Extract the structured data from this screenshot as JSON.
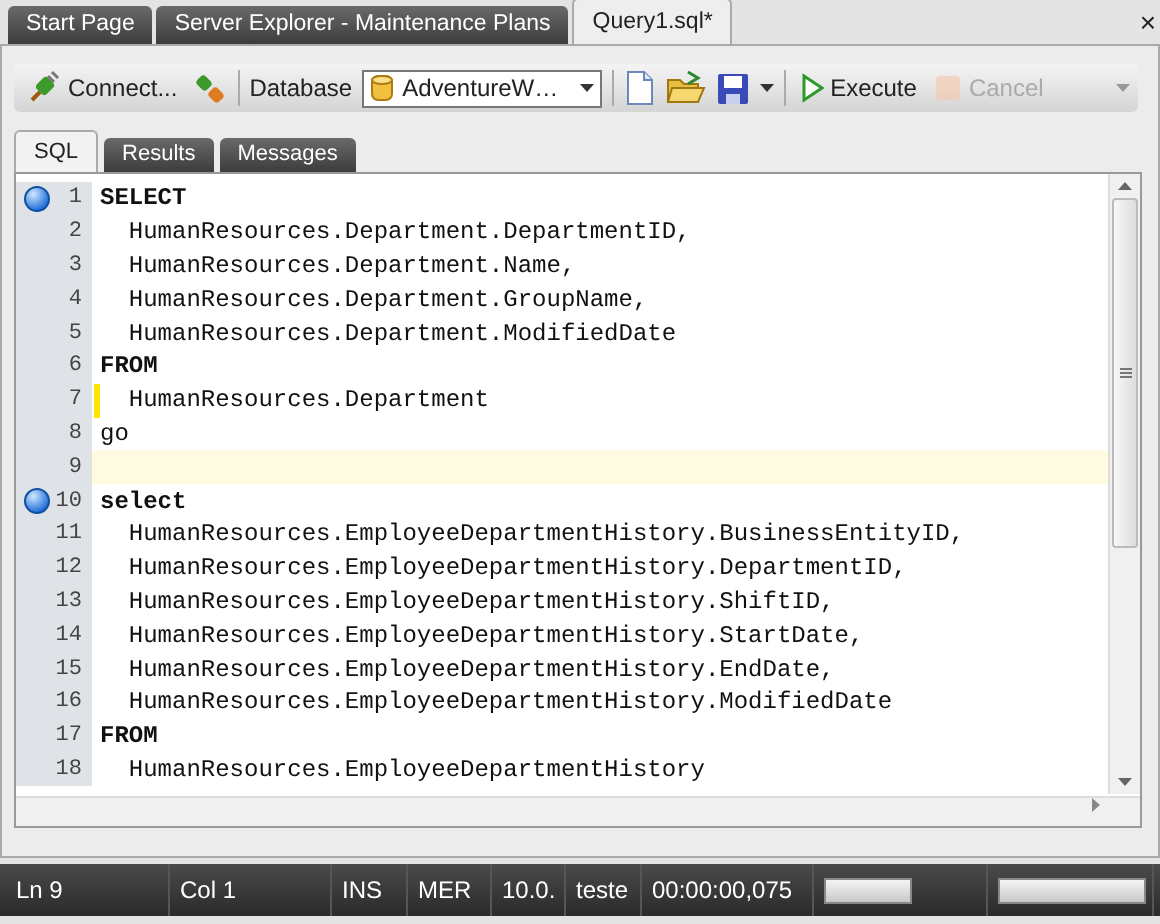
{
  "doc_tabs": [
    {
      "label": "Start Page",
      "selected": false
    },
    {
      "label": "Server Explorer - Maintenance Plans",
      "selected": false
    },
    {
      "label": "Query1.sql*",
      "selected": true
    }
  ],
  "close_glyph": "×",
  "toolbar": {
    "connect": "Connect...",
    "database_label": "Database",
    "database": "AdventureW…",
    "execute": {
      "label": "Execute",
      "disabled": false
    },
    "cancel": {
      "label": "Cancel",
      "disabled": true
    }
  },
  "result_tabs": [
    {
      "label": "SQL",
      "selected": true
    },
    {
      "label": "Results",
      "selected": false
    },
    {
      "label": "Messages",
      "selected": false
    }
  ],
  "editor": {
    "lines": [
      {
        "num": "1",
        "kind": "keyword",
        "text": "SELECT",
        "breakpoint": true,
        "modified": false,
        "current": false
      },
      {
        "num": "2",
        "kind": "code",
        "text": "  HumanResources.Department.DepartmentID,",
        "breakpoint": false,
        "modified": false,
        "current": false
      },
      {
        "num": "3",
        "kind": "code",
        "text": "  HumanResources.Department.Name,",
        "breakpoint": false,
        "modified": false,
        "current": false
      },
      {
        "num": "4",
        "kind": "code",
        "text": "  HumanResources.Department.GroupName,",
        "breakpoint": false,
        "modified": false,
        "current": false
      },
      {
        "num": "5",
        "kind": "code",
        "text": "  HumanResources.Department.ModifiedDate",
        "breakpoint": false,
        "modified": false,
        "current": false
      },
      {
        "num": "6",
        "kind": "keyword",
        "text": "FROM",
        "breakpoint": false,
        "modified": false,
        "current": false
      },
      {
        "num": "7",
        "kind": "code",
        "text": "  HumanResources.Department",
        "breakpoint": false,
        "modified": true,
        "current": false
      },
      {
        "num": "8",
        "kind": "code",
        "text": "go",
        "breakpoint": false,
        "modified": false,
        "current": false
      },
      {
        "num": "9",
        "breakpoint": false,
        "modified": false,
        "current": true
      },
      {
        "num": "10",
        "kind": "keyword",
        "text": "select",
        "breakpoint": true,
        "modified": false,
        "current": false
      },
      {
        "num": "11",
        "kind": "code",
        "text": "  HumanResources.EmployeeDepartmentHistory.BusinessEntityID,",
        "breakpoint": false,
        "modified": false,
        "current": false
      },
      {
        "num": "12",
        "kind": "code",
        "text": "  HumanResources.EmployeeDepartmentHistory.DepartmentID,",
        "breakpoint": false,
        "modified": false,
        "current": false
      },
      {
        "num": "13",
        "kind": "code",
        "text": "  HumanResources.EmployeeDepartmentHistory.ShiftID,",
        "breakpoint": false,
        "modified": false,
        "current": false
      },
      {
        "num": "14",
        "kind": "code",
        "text": "  HumanResources.EmployeeDepartmentHistory.StartDate,",
        "breakpoint": false,
        "modified": false,
        "current": false
      },
      {
        "num": "15",
        "kind": "code",
        "text": "  HumanResources.EmployeeDepartmentHistory.EndDate,",
        "breakpoint": false,
        "modified": false,
        "current": false
      },
      {
        "num": "16",
        "kind": "code",
        "text": "  HumanResources.EmployeeDepartmentHistory.ModifiedDate",
        "breakpoint": false,
        "modified": false,
        "current": false
      },
      {
        "num": "17",
        "kind": "keyword",
        "text": "FROM",
        "breakpoint": false,
        "modified": false,
        "current": false
      },
      {
        "num": "18",
        "kind": "code",
        "text": "  HumanResources.EmployeeDepartmentHistory",
        "breakpoint": false,
        "modified": false,
        "current": false
      }
    ]
  },
  "status_bar": [
    {
      "kind": "text",
      "text": "Ln 9"
    },
    {
      "kind": "text",
      "text": "Col 1"
    },
    {
      "kind": "text",
      "text": "INS"
    },
    {
      "kind": "text",
      "text": "MER"
    },
    {
      "kind": "text",
      "text": "10.0."
    },
    {
      "kind": "text",
      "text": "teste"
    },
    {
      "kind": "text",
      "text": "00:00:00,075"
    },
    {
      "kind": "panel"
    },
    {
      "kind": "panel"
    }
  ]
}
